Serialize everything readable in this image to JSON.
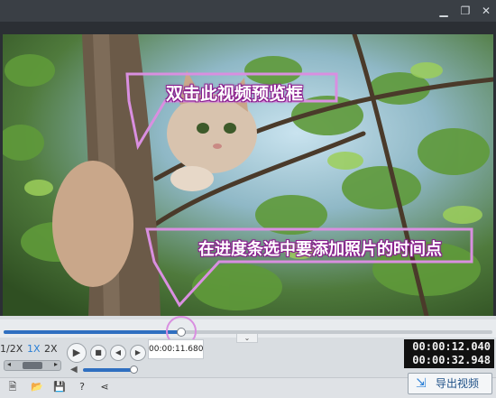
{
  "window": {
    "minimize_icon": "minimize-icon",
    "maximize_icon": "restore-icon",
    "close_icon": "close-icon",
    "minimize_glyph": "▁",
    "restore_glyph": "❐",
    "close_glyph": "✕"
  },
  "preview": {
    "annotation_top": "双击此视频预览框",
    "annotation_bottom": "在进度条选中要添加照片的时间点",
    "colors": {
      "accent_pink": "#d98fe0",
      "annotation_outline": "#8a1f8f"
    }
  },
  "timeline": {
    "progress_percent": 37,
    "collapse_glyph": "⌄"
  },
  "controls": {
    "speed_half": "1/2X",
    "speed_1x": "1X",
    "speed_2x": "2X",
    "speed_prev_glyph": "◂",
    "speed_next_glyph": "▸",
    "play_glyph": "▶",
    "stop_glyph": "■",
    "prev_glyph": "◀",
    "next_glyph": "▶",
    "volume_glyph": "◀",
    "volume_level_percent": 95,
    "current_time_tip": "00:00:11.680"
  },
  "time_display": {
    "current": "00:00:12.040",
    "total": "00:00:32.948"
  },
  "bottom": {
    "export_label": "导出视频",
    "export_glyph": "⇲",
    "tools": {
      "new_glyph": "🗎",
      "open_glyph": "📂",
      "save_glyph": "💾",
      "help_glyph": "?",
      "share_glyph": "⋖"
    }
  }
}
